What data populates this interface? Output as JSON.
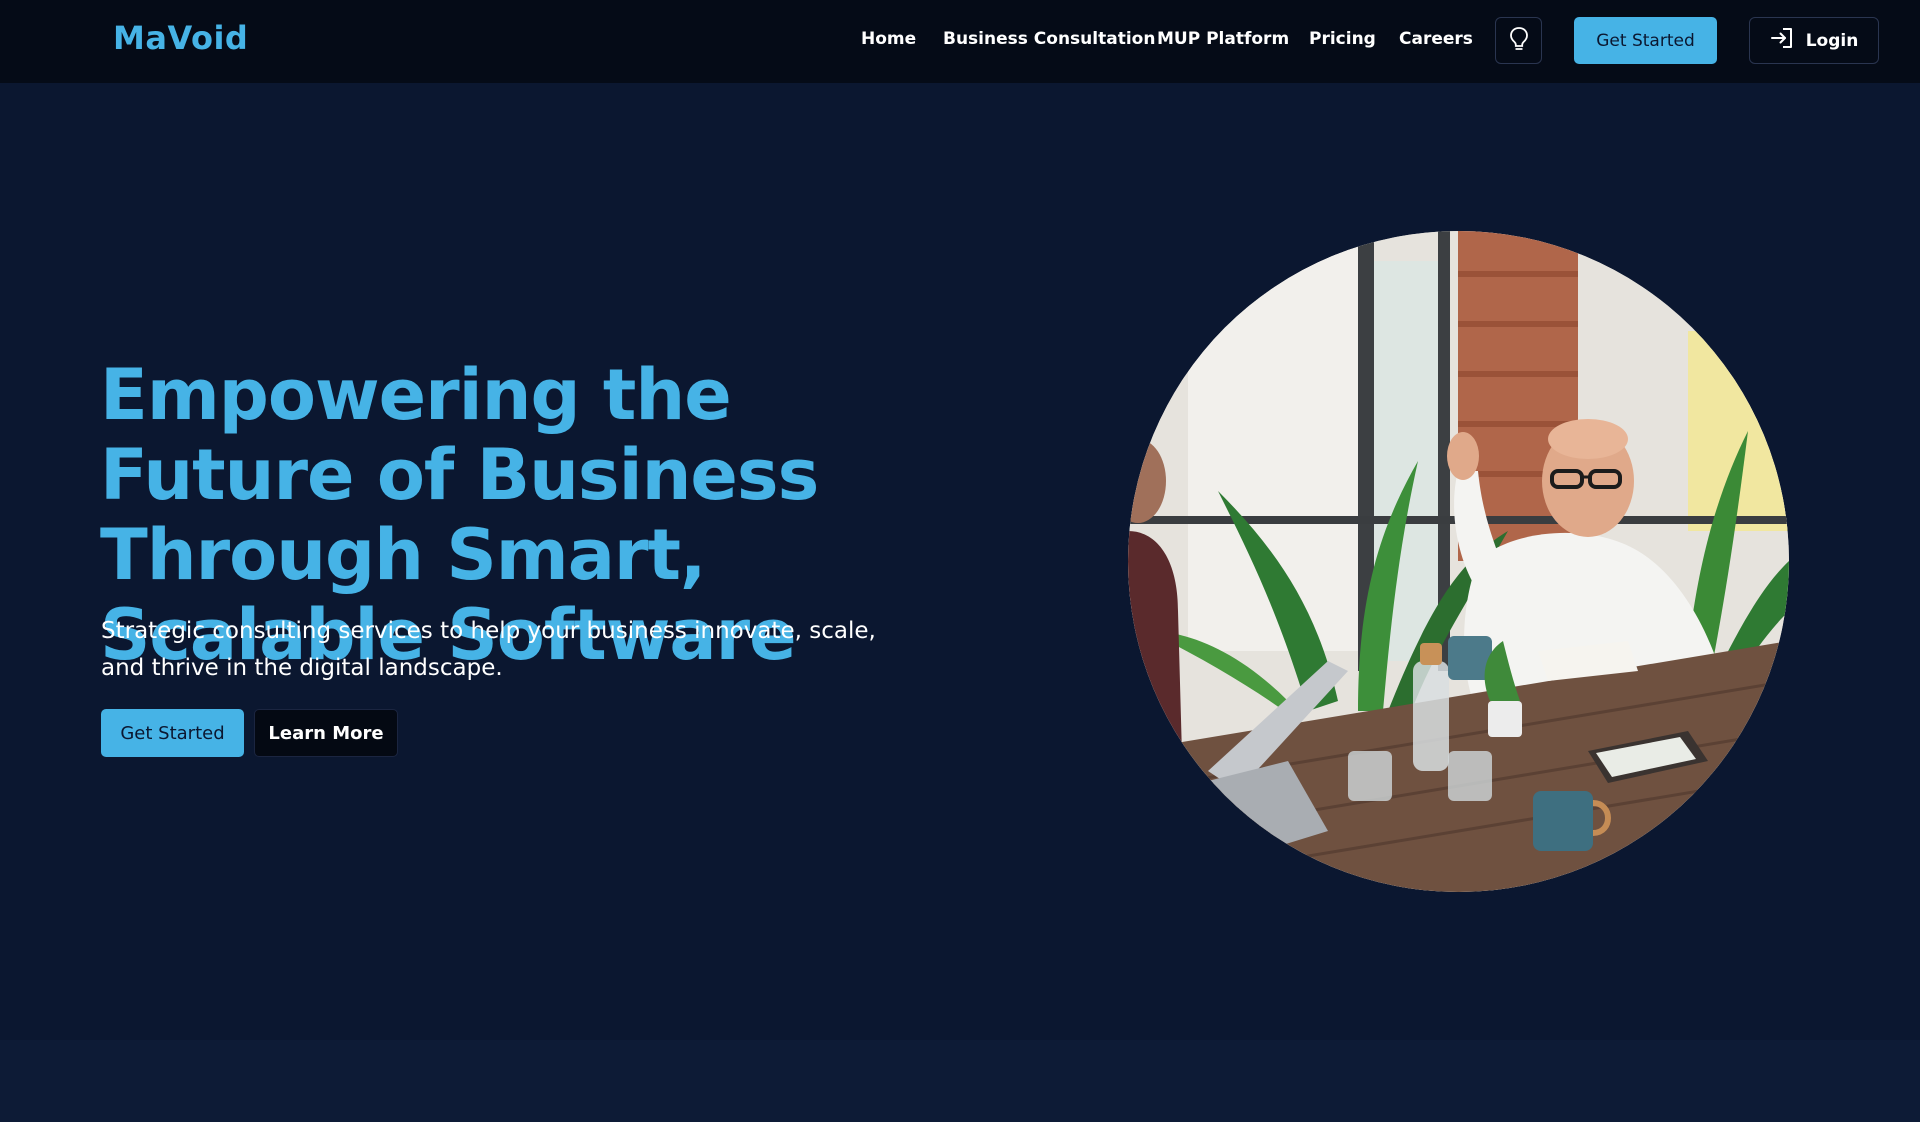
{
  "nav": {
    "brand": "MaVoid",
    "links": [
      "Home",
      "Business Consultation",
      "MUP Platform",
      "Pricing",
      "Careers"
    ],
    "theme_icon": "lightbulb-icon",
    "cta_label": "Get Started",
    "login_label": "Login",
    "login_icon": "sign-in-icon"
  },
  "hero": {
    "title": "Empowering the Future of Business Through Smart, Scalable Software",
    "subtitle": "Strategic consulting services to help your business innovate, scale, and thrive in the digital landscape.",
    "primary_label": "Get Started",
    "secondary_label": "Learn More"
  },
  "colors": {
    "accent": "#46b3e6",
    "background": "#0b1730",
    "nav_background": "#050b17"
  }
}
